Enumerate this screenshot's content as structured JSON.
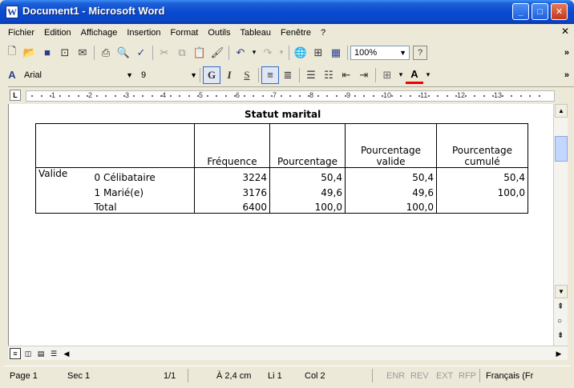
{
  "window": {
    "title": "Document1 - Microsoft Word",
    "icon": "word-doc-icon"
  },
  "menu": [
    "Fichier",
    "Edition",
    "Affichage",
    "Insertion",
    "Format",
    "Outils",
    "Tableau",
    "Fenêtre",
    "?"
  ],
  "toolbar": {
    "zoom": "100%",
    "help": "?"
  },
  "format_toolbar": {
    "font": "Arial",
    "size": "9",
    "bold": "G",
    "italic": "I",
    "underline": "S"
  },
  "ruler": [
    "1",
    "2",
    "3",
    "4",
    "5",
    "6",
    "7",
    "8",
    "9",
    "10",
    "11",
    "12",
    "13"
  ],
  "document": {
    "table_title": "Statut marital",
    "headers": [
      "Fréquence",
      "Pourcentage",
      "Pourcentage valide",
      "Pourcentage cumulé"
    ],
    "group_label": "Valide",
    "rows": [
      {
        "label": "0  Célibataire",
        "freq": "3224",
        "pct": "50,4",
        "valid": "50,4",
        "cum": "50,4"
      },
      {
        "label": "1  Marié(e)",
        "freq": "3176",
        "pct": "49,6",
        "valid": "49,6",
        "cum": "100,0"
      },
      {
        "label": "Total",
        "freq": "6400",
        "pct": "100,0",
        "valid": "100,0",
        "cum": ""
      }
    ]
  },
  "status": {
    "page": "Page 1",
    "section": "Sec 1",
    "pages": "1/1",
    "at": "À 2,4 cm",
    "line": "Li 1",
    "col": "Col 2",
    "enr": "ENR",
    "rev": "REV",
    "ext": "EXT",
    "rfp": "RFP",
    "lang": "Français (Fr"
  }
}
